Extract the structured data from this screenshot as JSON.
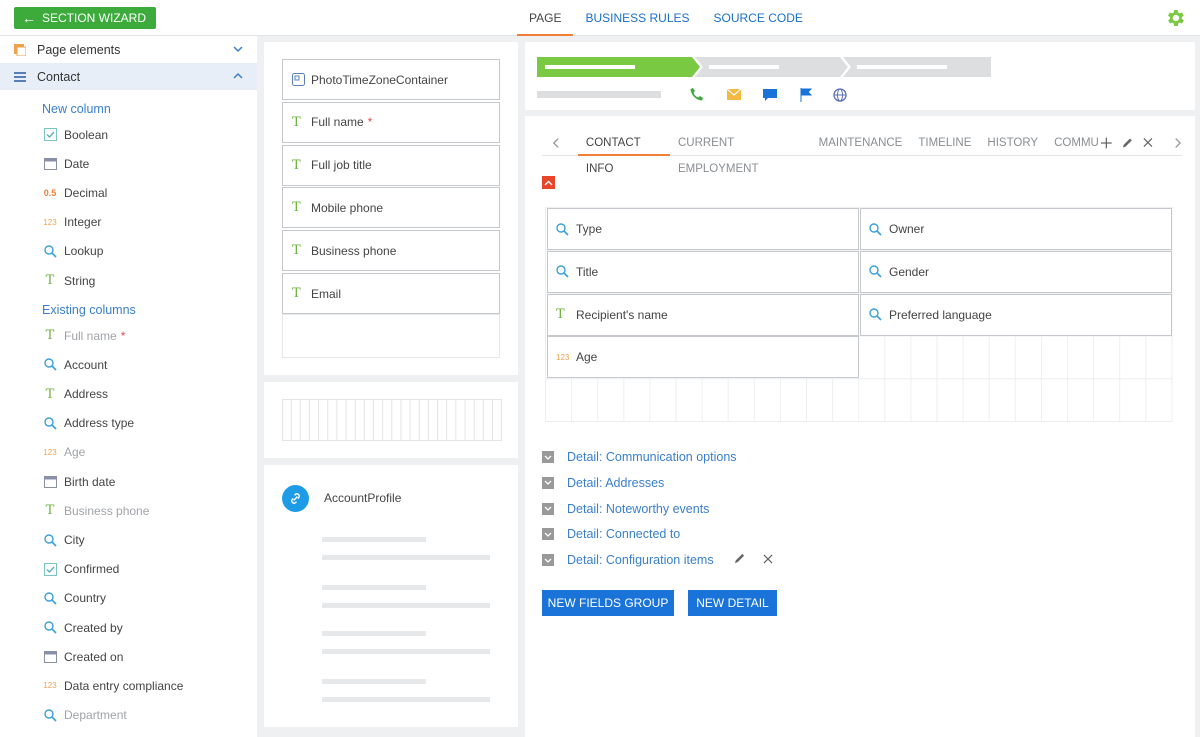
{
  "topbar": {
    "wizard_label": "SECTION WIZARD",
    "tabs": [
      "PAGE",
      "BUSINESS RULES",
      "SOURCE CODE"
    ]
  },
  "sidebar": {
    "sections": [
      "Page elements",
      "Contact"
    ],
    "new_column_title": "New column",
    "new_columns": [
      {
        "label": "Boolean",
        "icon": "checkbox-icon"
      },
      {
        "label": "Date",
        "icon": "calendar-icon"
      },
      {
        "label": "Decimal",
        "icon": "decimal-icon",
        "glyph": "0.5"
      },
      {
        "label": "Integer",
        "icon": "integer-icon",
        "glyph": "123"
      },
      {
        "label": "Lookup",
        "icon": "search-icon"
      },
      {
        "label": "String",
        "icon": "text-icon",
        "glyph": "T"
      }
    ],
    "existing_column_title": "Existing columns",
    "existing_columns": [
      {
        "label": "Full name",
        "icon": "text-icon",
        "glyph": "T",
        "muted": true,
        "required": true
      },
      {
        "label": "Account",
        "icon": "search-icon"
      },
      {
        "label": "Address",
        "icon": "text-icon",
        "glyph": "T"
      },
      {
        "label": "Address type",
        "icon": "search-icon"
      },
      {
        "label": "Age",
        "icon": "integer-icon",
        "glyph": "123",
        "muted": true
      },
      {
        "label": "Birth date",
        "icon": "calendar-icon"
      },
      {
        "label": "Business phone",
        "icon": "text-icon",
        "glyph": "T",
        "muted": true
      },
      {
        "label": "City",
        "icon": "search-icon"
      },
      {
        "label": "Confirmed",
        "icon": "checkbox-icon"
      },
      {
        "label": "Country",
        "icon": "search-icon"
      },
      {
        "label": "Created by",
        "icon": "search-icon"
      },
      {
        "label": "Created on",
        "icon": "calendar-icon"
      },
      {
        "label": "Data entry compliance",
        "icon": "integer-icon",
        "glyph": "123"
      },
      {
        "label": "Department",
        "icon": "search-icon",
        "muted": true
      }
    ]
  },
  "profile_fields": [
    {
      "label": "PhotoTimeZoneContainer",
      "icon": "container-icon"
    },
    {
      "label": "Full name",
      "icon": "text-icon",
      "glyph": "T",
      "required": true
    },
    {
      "label": "Full job title",
      "icon": "text-icon",
      "glyph": "T"
    },
    {
      "label": "Mobile phone",
      "icon": "text-icon",
      "glyph": "T"
    },
    {
      "label": "Business phone",
      "icon": "text-icon",
      "glyph": "T"
    },
    {
      "label": "Email",
      "icon": "text-icon",
      "glyph": "T"
    }
  ],
  "account_profile": {
    "label": "AccountProfile"
  },
  "tabs": [
    "CONTACT INFO",
    "CURRENT EMPLOYMENT",
    "MAINTENANCE",
    "TIMELINE",
    "HISTORY",
    "COMMU"
  ],
  "contact_fields": [
    {
      "label": "Type",
      "icon": "search-icon"
    },
    {
      "label": "Owner",
      "icon": "search-icon"
    },
    {
      "label": "Title",
      "icon": "search-icon"
    },
    {
      "label": "Gender",
      "icon": "search-icon"
    },
    {
      "label": "Recipient's name",
      "icon": "text-icon",
      "glyph": "T"
    },
    {
      "label": "Preferred language",
      "icon": "search-icon"
    },
    {
      "label": "Age",
      "icon": "integer-icon",
      "glyph": "123"
    }
  ],
  "details": [
    "Detail: Communication options",
    "Detail: Addresses",
    "Detail: Noteworthy events",
    "Detail: Connected to",
    "Detail: Configuration items"
  ],
  "buttons": {
    "new_fields_group": "NEW FIELDS GROUP",
    "new_detail": "NEW DETAIL"
  },
  "colors": {
    "accent_green": "#3cab3c",
    "accent_blue": "#1a73d9",
    "accent_orange": "#f17f38",
    "link_blue": "#3a7fcc"
  }
}
